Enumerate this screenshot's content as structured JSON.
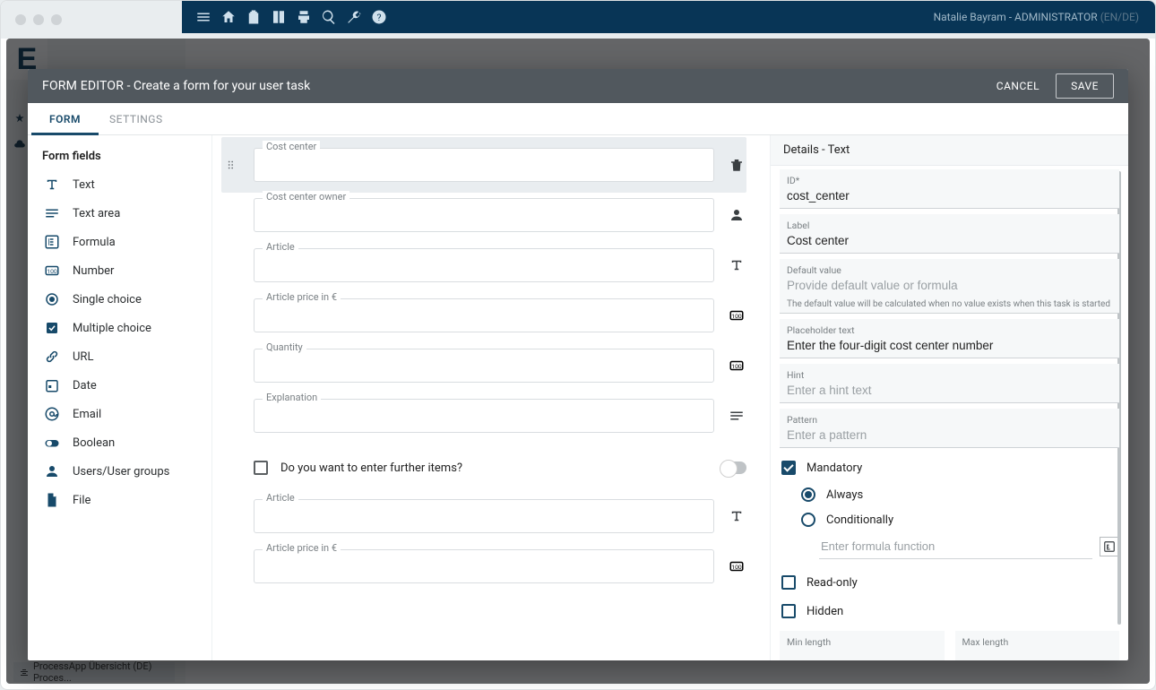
{
  "topnav": {
    "user": "Natalie Bayram - ADMINISTRATOR",
    "lang": "(EN/DE)"
  },
  "footer": {
    "text": "ProcessApp Übersicht (DE) Proces..."
  },
  "modal": {
    "title_main": "FORM EDITOR",
    "title_sub": "- Create a form for your user task",
    "cancel": "CANCEL",
    "save": "SAVE",
    "tabs": {
      "form": "FORM",
      "settings": "SETTINGS"
    }
  },
  "palette": {
    "heading": "Form fields",
    "items": [
      {
        "key": "text",
        "label": "Text"
      },
      {
        "key": "textarea",
        "label": "Text area"
      },
      {
        "key": "formula",
        "label": "Formula"
      },
      {
        "key": "number",
        "label": "Number"
      },
      {
        "key": "single",
        "label": "Single choice"
      },
      {
        "key": "multiple",
        "label": "Multiple choice"
      },
      {
        "key": "url",
        "label": "URL"
      },
      {
        "key": "date",
        "label": "Date"
      },
      {
        "key": "email",
        "label": "Email"
      },
      {
        "key": "boolean",
        "label": "Boolean"
      },
      {
        "key": "users",
        "label": "Users/User groups"
      },
      {
        "key": "file",
        "label": "File"
      }
    ]
  },
  "canvas": {
    "rows": [
      {
        "label": "Cost center",
        "icon": "trash-icon",
        "selected": true
      },
      {
        "label": "Cost center owner",
        "icon": "person-icon"
      },
      {
        "label": "Article",
        "icon": "text-icon"
      },
      {
        "label": "Article price in €",
        "icon": "number-icon"
      },
      {
        "label": "Quantity",
        "icon": "number-icon"
      },
      {
        "label": "Explanation",
        "icon": "textarea-icon"
      }
    ],
    "checkbox_question": "Do you want to enter further items?",
    "extra_rows": [
      {
        "label": "Article",
        "icon": "text-icon"
      },
      {
        "label": "Article price in €",
        "icon": "number-icon"
      }
    ]
  },
  "details": {
    "heading": "Details - Text",
    "id_label": "ID*",
    "id_value": "cost_center",
    "label_label": "Label",
    "label_value": "Cost center",
    "default_label": "Default value",
    "default_placeholder": "Provide default value or formula",
    "default_help": "The default value will be calculated when no value exists when this task is started",
    "placeholder_label": "Placeholder text",
    "placeholder_value": "Enter the four-digit cost center number",
    "hint_label": "Hint",
    "hint_placeholder": "Enter a hint text",
    "pattern_label": "Pattern",
    "pattern_placeholder": "Enter a pattern",
    "mandatory": "Mandatory",
    "always": "Always",
    "conditionally": "Conditionally",
    "formula_placeholder": "Enter formula function",
    "readonly": "Read-only",
    "hidden": "Hidden",
    "min_label": "Min length",
    "max_label": "Max length"
  }
}
